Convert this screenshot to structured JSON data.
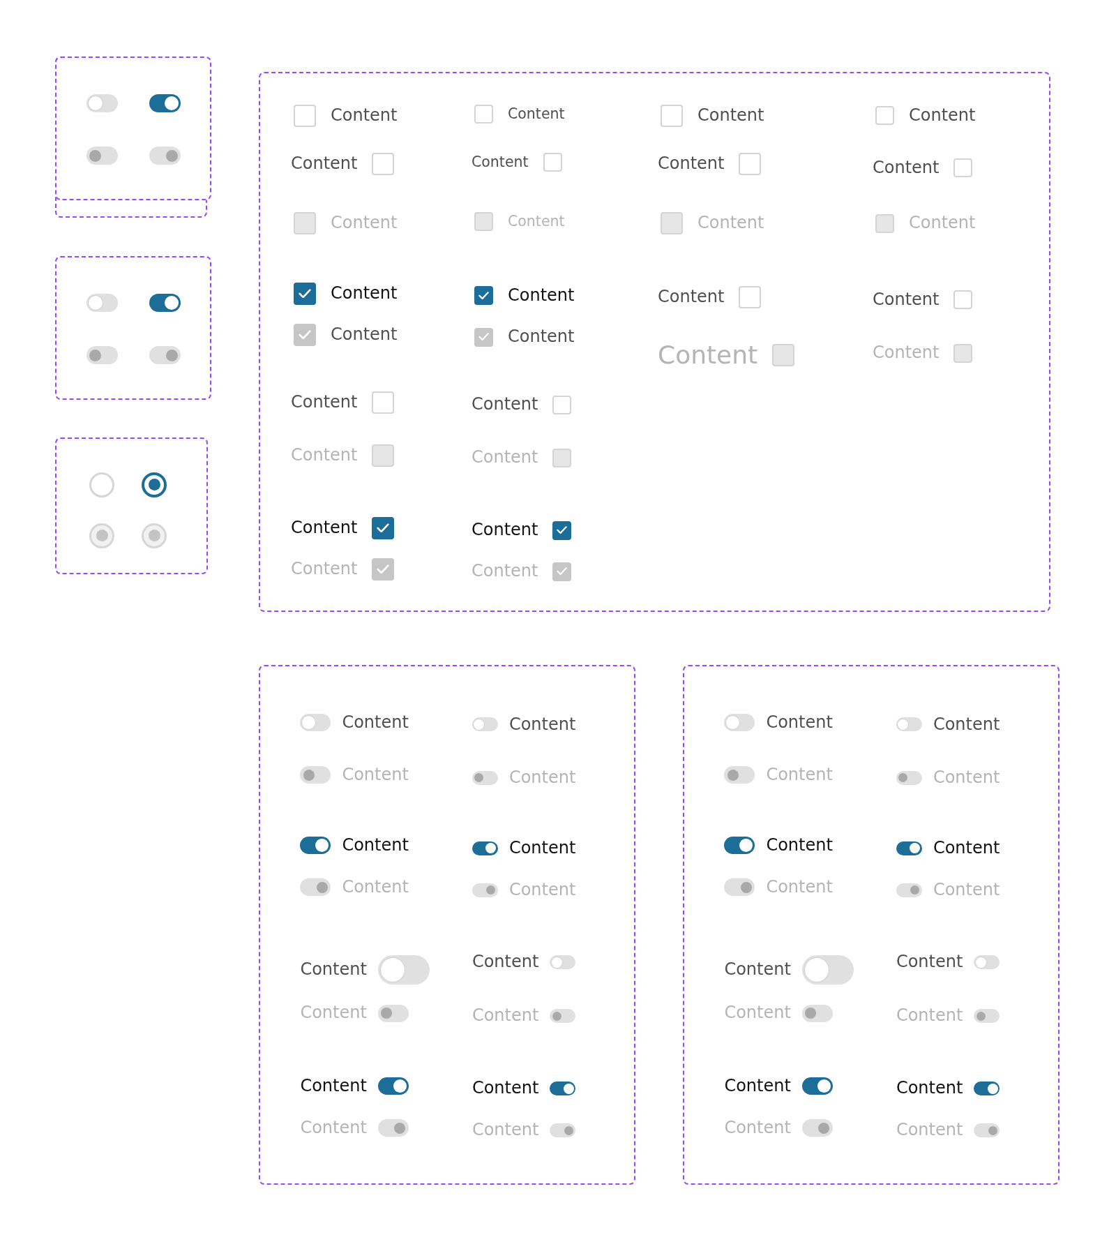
{
  "toggle_sheets": [
    {
      "stacked": true,
      "toggles": [
        {
          "on": false,
          "disabled": false
        },
        {
          "on": true,
          "disabled": false
        },
        {
          "on": false,
          "disabled": true
        },
        {
          "on": true,
          "disabled": true
        }
      ]
    },
    {
      "stacked": false,
      "toggles": [
        {
          "on": false,
          "disabled": false
        },
        {
          "on": true,
          "disabled": false
        },
        {
          "on": false,
          "disabled": true
        },
        {
          "on": true,
          "disabled": true
        }
      ]
    }
  ],
  "radio_sheet": {
    "radios": [
      {
        "selected": false,
        "disabled": false
      },
      {
        "selected": true,
        "disabled": false
      },
      {
        "selected": true,
        "disabled": true
      },
      {
        "selected": true,
        "disabled": true
      }
    ]
  },
  "checkbox_sheet": {
    "columns": [
      {
        "items": [
          {
            "label": "Content",
            "kind": "leading",
            "checked": false,
            "disabled": false,
            "label_disabled": false
          },
          {
            "label": "Content",
            "kind": "trailing",
            "checked": false,
            "disabled": false,
            "label_disabled": false
          },
          {
            "label": "Content",
            "kind": "leading",
            "checked": false,
            "disabled": true,
            "label_disabled": true
          },
          {
            "label": "Content",
            "kind": "leading",
            "checked": true,
            "disabled": false,
            "label_disabled": false
          },
          {
            "label": "Content",
            "kind": "leading",
            "checked": true,
            "disabled": true,
            "label_disabled": false
          },
          {
            "label": "Content",
            "kind": "trailing",
            "checked": false,
            "disabled": false,
            "label_disabled": false
          },
          {
            "label": "Content",
            "kind": "trailing",
            "checked": false,
            "disabled": true,
            "label_disabled": true
          },
          {
            "label": "Content",
            "kind": "trailing",
            "checked": true,
            "disabled": false,
            "label_disabled": false
          },
          {
            "label": "Content",
            "kind": "trailing",
            "checked": true,
            "disabled": true,
            "label_disabled": true
          }
        ]
      },
      {
        "items": [
          {
            "label": "Content",
            "kind": "leading",
            "checked": false,
            "disabled": false,
            "label_disabled": false
          },
          {
            "label": "Content",
            "kind": "trailing",
            "checked": false,
            "disabled": false,
            "label_disabled": false
          },
          {
            "label": "Content",
            "kind": "leading",
            "checked": false,
            "disabled": true,
            "label_disabled": true
          },
          {
            "label": "Content",
            "kind": "leading",
            "checked": true,
            "disabled": false,
            "label_disabled": false
          },
          {
            "label": "Content",
            "kind": "leading",
            "checked": true,
            "disabled": true,
            "label_disabled": false
          },
          {
            "label": "Content",
            "kind": "trailing",
            "checked": false,
            "disabled": false,
            "label_disabled": false
          },
          {
            "label": "Content",
            "kind": "trailing",
            "checked": false,
            "disabled": true,
            "label_disabled": true
          },
          {
            "label": "Content",
            "kind": "trailing",
            "checked": true,
            "disabled": false,
            "label_disabled": false
          },
          {
            "label": "Content",
            "kind": "trailing",
            "checked": true,
            "disabled": true,
            "label_disabled": true
          }
        ]
      },
      {
        "items": [
          {
            "label": "Content",
            "kind": "leading",
            "checked": false,
            "disabled": false,
            "label_disabled": false
          },
          {
            "label": "Content",
            "kind": "trailing",
            "checked": false,
            "disabled": false,
            "label_disabled": false
          },
          {
            "label": "Content",
            "kind": "leading",
            "checked": false,
            "disabled": true,
            "label_disabled": true
          },
          {
            "label": "Content",
            "kind": "trailing",
            "checked": false,
            "disabled": false,
            "label_disabled": false
          },
          {
            "label": "Content",
            "kind": "trailing",
            "checked": false,
            "disabled": true,
            "label_disabled": true
          }
        ]
      },
      {
        "items": [
          {
            "label": "Content",
            "kind": "leading",
            "checked": false,
            "disabled": false,
            "label_disabled": false
          },
          {
            "label": "Content",
            "kind": "trailing",
            "checked": false,
            "disabled": false,
            "label_disabled": false
          },
          {
            "label": "Content",
            "kind": "leading",
            "checked": false,
            "disabled": true,
            "label_disabled": true
          },
          {
            "label": "Content",
            "kind": "trailing",
            "checked": false,
            "disabled": false,
            "label_disabled": false
          },
          {
            "label": "Content",
            "kind": "trailing",
            "checked": false,
            "disabled": true,
            "label_disabled": true
          }
        ]
      }
    ]
  },
  "toggle_label_sheets": [
    {
      "columns": [
        {
          "items": [
            {
              "label": "Content",
              "kind": "leading",
              "on": false,
              "disabled": false
            },
            {
              "label": "Content",
              "kind": "leading",
              "on": false,
              "disabled": true
            },
            {
              "label": "Content",
              "kind": "leading",
              "on": true,
              "disabled": false
            },
            {
              "label": "Content",
              "kind": "leading",
              "on": true,
              "disabled": true
            },
            {
              "label": "Content",
              "kind": "trailing",
              "on": false,
              "disabled": false
            },
            {
              "label": "Content",
              "kind": "trailing",
              "on": false,
              "disabled": true
            },
            {
              "label": "Content",
              "kind": "trailing",
              "on": true,
              "disabled": false
            },
            {
              "label": "Content",
              "kind": "trailing",
              "on": true,
              "disabled": true
            }
          ]
        },
        {
          "items": [
            {
              "label": "Content",
              "kind": "leading",
              "on": false,
              "disabled": false
            },
            {
              "label": "Content",
              "kind": "leading",
              "on": false,
              "disabled": true
            },
            {
              "label": "Content",
              "kind": "leading",
              "on": true,
              "disabled": false
            },
            {
              "label": "Content",
              "kind": "leading",
              "on": true,
              "disabled": true
            },
            {
              "label": "Content",
              "kind": "trailing",
              "on": false,
              "disabled": false
            },
            {
              "label": "Content",
              "kind": "trailing",
              "on": false,
              "disabled": true
            },
            {
              "label": "Content",
              "kind": "trailing",
              "on": true,
              "disabled": false
            },
            {
              "label": "Content",
              "kind": "trailing",
              "on": true,
              "disabled": true
            }
          ]
        }
      ]
    },
    {
      "columns": [
        {
          "items": [
            {
              "label": "Content",
              "kind": "leading",
              "on": false,
              "disabled": false
            },
            {
              "label": "Content",
              "kind": "leading",
              "on": false,
              "disabled": true
            },
            {
              "label": "Content",
              "kind": "leading",
              "on": true,
              "disabled": false
            },
            {
              "label": "Content",
              "kind": "leading",
              "on": true,
              "disabled": true
            },
            {
              "label": "Content",
              "kind": "trailing",
              "on": false,
              "disabled": false
            },
            {
              "label": "Content",
              "kind": "trailing",
              "on": false,
              "disabled": true
            },
            {
              "label": "Content",
              "kind": "trailing",
              "on": true,
              "disabled": false
            },
            {
              "label": "Content",
              "kind": "trailing",
              "on": true,
              "disabled": true
            }
          ]
        },
        {
          "items": [
            {
              "label": "Content",
              "kind": "leading",
              "on": false,
              "disabled": false
            },
            {
              "label": "Content",
              "kind": "leading",
              "on": false,
              "disabled": true
            },
            {
              "label": "Content",
              "kind": "leading",
              "on": true,
              "disabled": false
            },
            {
              "label": "Content",
              "kind": "leading",
              "on": true,
              "disabled": true
            },
            {
              "label": "Content",
              "kind": "trailing",
              "on": false,
              "disabled": false
            },
            {
              "label": "Content",
              "kind": "trailing",
              "on": false,
              "disabled": true
            },
            {
              "label": "Content",
              "kind": "trailing",
              "on": true,
              "disabled": false
            },
            {
              "label": "Content",
              "kind": "trailing",
              "on": true,
              "disabled": true
            }
          ]
        }
      ]
    }
  ]
}
